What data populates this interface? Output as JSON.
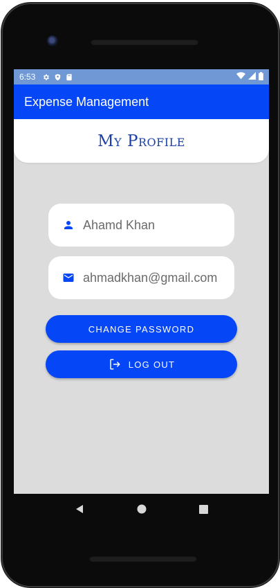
{
  "status_bar": {
    "time": "6:53",
    "icons": [
      "gear-icon",
      "shield-icon",
      "sd-card-icon",
      "wifi-icon",
      "signal-icon",
      "battery-icon"
    ]
  },
  "app_bar": {
    "title": "Expense Management"
  },
  "profile": {
    "title": "My Profile",
    "name": "Ahamd Khan",
    "email": "ahmadkhan@gmail.com",
    "name_icon": "person-icon",
    "email_icon": "mail-icon"
  },
  "actions": {
    "change_password_label": "CHANGE PASSWORD",
    "logout_label": "LOG OUT",
    "logout_icon": "logout-icon"
  },
  "nav": {
    "icons": [
      "back-icon",
      "home-icon",
      "recents-icon"
    ]
  },
  "colors": {
    "primary": "#0546f6",
    "status_bar": "#6f98d4",
    "background": "#dcdcdc",
    "title_text": "#1a3fa6"
  }
}
